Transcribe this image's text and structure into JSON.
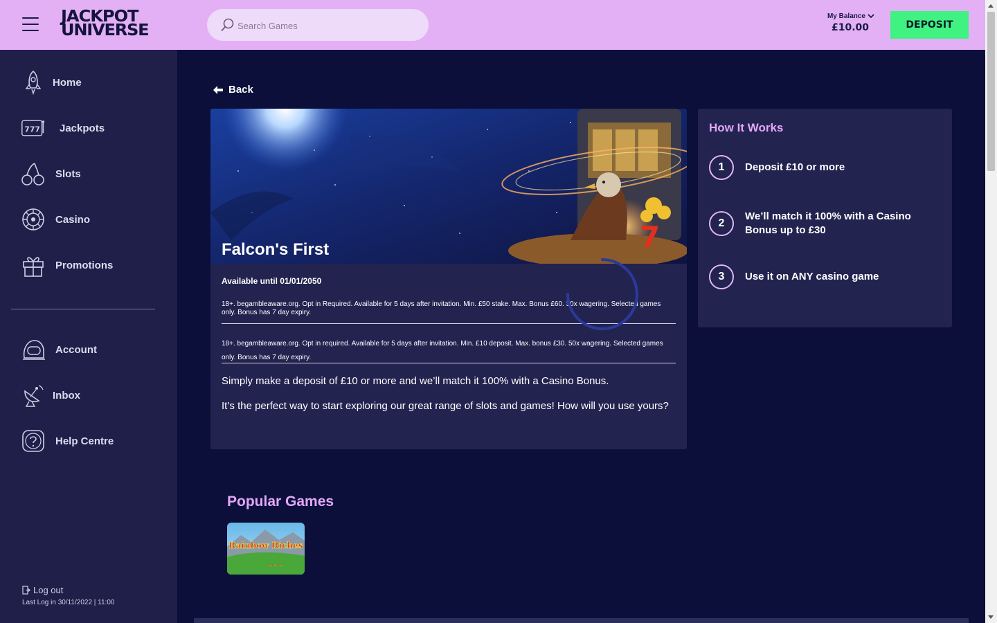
{
  "header": {
    "logo_line1": "JACKPOT",
    "logo_line2": "UNIVERSE",
    "search_placeholder": "Search Games",
    "balance_label": "My Balance",
    "balance_amount": "£10.00",
    "deposit_label": "DEPOSIT"
  },
  "sidebar": {
    "items": [
      {
        "label": "Home",
        "icon": "rocket-icon"
      },
      {
        "label": "Jackpots",
        "icon": "slot-machine-icon"
      },
      {
        "label": "Slots",
        "icon": "cherries-icon"
      },
      {
        "label": "Casino",
        "icon": "roulette-icon"
      },
      {
        "label": "Promotions",
        "icon": "gift-icon"
      },
      {
        "label": "Account",
        "icon": "astronaut-helmet-icon"
      },
      {
        "label": "Inbox",
        "icon": "satellite-dish-icon"
      },
      {
        "label": "Help Centre",
        "icon": "help-question-icon"
      }
    ],
    "logout_label": "Log out",
    "last_login": "Last Log in 30/11/2022 | 11:00"
  },
  "main": {
    "back_label": "Back",
    "promo": {
      "title": "Falcon's First",
      "available": "Available until 01/01/2050",
      "terms1": "18+. begambleaware.org. Opt in Required. Available for 5 days after invitation. Min. £50 stake. Max. Bonus £60. 30x wagering. Selected games only. Bonus has 7 day expiry.",
      "terms2": "18+. begambleaware.org. Opt in required. Available for 5 days after invitation. Min. £10 deposit. Max. bonus £30. 50x wagering. Selected games only. Bonus has 7 day expiry.",
      "desc1": "Simply make a deposit of £10 or more and we’ll match it 100% with a Casino Bonus.",
      "desc2": "It’s the perfect way to start exploring our great range of slots and games! How will you use yours?"
    },
    "how_it_works": {
      "title": "How It Works",
      "steps": [
        {
          "num": "1",
          "text": "Deposit £10 or more"
        },
        {
          "num": "2",
          "text": "We’ll match it 100% with a Casino Bonus up to £30"
        },
        {
          "num": "3",
          "text": "Use it on ANY casino game"
        }
      ]
    },
    "popular_title": "Popular Games",
    "game_thumb_text": "Rainbow Riches"
  },
  "colors": {
    "header_bg": "#e3b0f5",
    "page_bg": "#0b0f3a",
    "sidebar_bg": "#1f1f49",
    "card_bg": "#232350",
    "accent_pink": "#e3a7f7",
    "deposit_green": "#3ff281"
  }
}
